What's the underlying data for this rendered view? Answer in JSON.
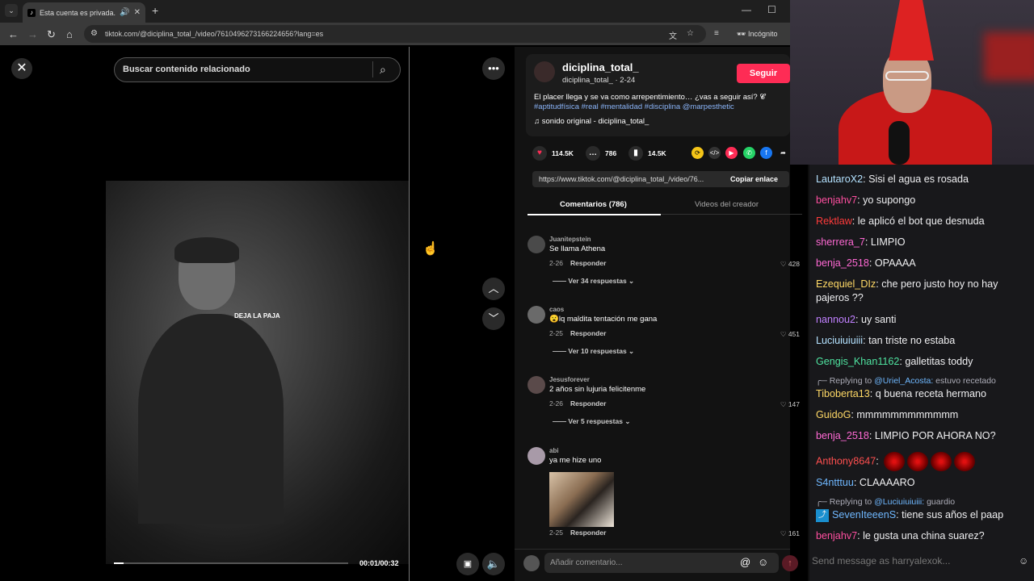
{
  "browser": {
    "tab_title": "Esta cuenta es privada. Sig",
    "url": "tiktok.com/@diciplina_total_/video/7610496273166224656?lang=es",
    "incognito_label": "Incógnito"
  },
  "video": {
    "search_placeholder": "Buscar contenido relacionado",
    "caption": "DEJA LA PAJA",
    "time": "00:01/00:32",
    "progress": 0.04
  },
  "creator": {
    "name": "diciplina_total_",
    "sub": "diciplina_total_ · 2-24",
    "follow_label": "Seguir",
    "description": "El placer llega y se va como arrepentimiento… ¿vas a seguir así? 𝓒",
    "tags": "#aptitudfísica #real #mentalidad #disciplina @marpesthetic",
    "music": "sonido original - diciplina_total_"
  },
  "stats": {
    "likes": "114.5K",
    "comments": "786",
    "saves": "14.5K"
  },
  "link": {
    "text": "https://www.tiktok.com/@diciplina_total_/video/76...",
    "copy_label": "Copiar enlace"
  },
  "tabs": {
    "comments": "Comentarios (786)",
    "creator_videos": "Videos del creador"
  },
  "comments": [
    {
      "user": "Juanitepstein",
      "text": "Se llama Athena",
      "date": "2-26",
      "reply": "Responder",
      "likes": "428",
      "view": "Ver 34 respuestas"
    },
    {
      "user": "caos",
      "text": "😮lq maldita tentación me gana",
      "date": "2-25",
      "reply": "Responder",
      "likes": "451",
      "view": "Ver 10 respuestas"
    },
    {
      "user": "Jesusforever",
      "text": "2 años sin lujuria felicitenme",
      "date": "2-26",
      "reply": "Responder",
      "likes": "147",
      "view": "Ver 5 respuestas"
    },
    {
      "user": "abi",
      "text": "ya me hize uno",
      "date": "2-25",
      "reply": "Responder",
      "likes": "161",
      "view": ""
    }
  ],
  "comment_input_placeholder": "Añadir comentario...",
  "chat": {
    "messages": [
      {
        "user": "LautaroX2",
        "color": "#b4e2ff",
        "text": "Sisi el agua es rosada"
      },
      {
        "user": "benjahv7",
        "color": "#ff4fa0",
        "text": "yo supongo"
      },
      {
        "user": "Rektlaw",
        "color": "#ff3b3b",
        "text": "le aplicó el bot que desnuda"
      },
      {
        "user": "sherrera_7",
        "color": "#ff69d4",
        "text": "LIMPIO"
      },
      {
        "user": "benja_2518",
        "color": "#ff69d4",
        "text": "OPAAAA"
      },
      {
        "user": "Ezequiel_DIz",
        "color": "#ffd966",
        "text": "che pero justo hoy no hay pajeros ??"
      },
      {
        "user": "nannou2",
        "color": "#c080ff",
        "text": "uy santi"
      },
      {
        "user": "Luciuiuiuiii",
        "color": "#b4e2ff",
        "text": "tan triste no estaba"
      },
      {
        "user": "Gengis_Khan1162",
        "color": "#4fe3a0",
        "text": "galletitas toddy"
      },
      {
        "user": "Tiboberta13",
        "color": "#ffd966",
        "text": "q buena receta hermano"
      },
      {
        "user": "GuidoG",
        "color": "#ffd966",
        "text": "mmmmmmmmmmmm"
      },
      {
        "user": "benja_2518",
        "color": "#ff69d4",
        "text": "LIMPIO POR AHORA NO?"
      },
      {
        "user": "Anthony8647",
        "color": "#ff4f4f",
        "text": ""
      },
      {
        "user": "S4ntttuu",
        "color": "#6fb8ff",
        "text": "CLAAAARO"
      },
      {
        "user": "SevenIteeenS",
        "color": "#6fb8ff",
        "text": "tiene sus años el paap"
      },
      {
        "user": "benjahv7",
        "color": "#ff4fa0",
        "text": "le gusta una china suarez?"
      }
    ],
    "reply1_prefix": "Replying to",
    "reply1_user": "@Uriel_Acosta:",
    "reply1_text": "estuvo recetado",
    "reply2_prefix": "Replying to",
    "reply2_user": "@Luciuiuiuiii:",
    "reply2_text": "guardio",
    "input_placeholder": "Send message as harryalexok..."
  },
  "icons": [
    "close-icon",
    "search-icon",
    "more-icon",
    "chevron-up-icon",
    "chevron-down-icon",
    "volume-icon",
    "heart-icon",
    "comment-icon",
    "bookmark-icon",
    "share-icon",
    "emoji-icon",
    "mention-icon",
    "send-icon",
    "music-icon"
  ]
}
